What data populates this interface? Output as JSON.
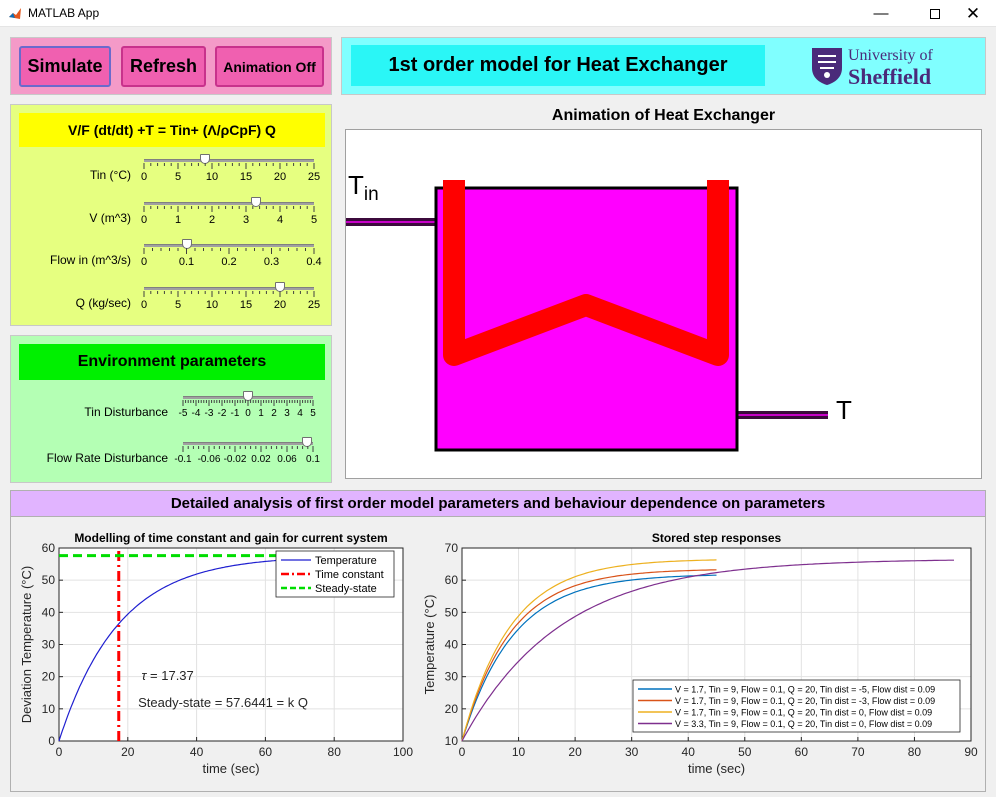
{
  "window": {
    "title": "MATLAB App"
  },
  "buttons": {
    "simulate": "Simulate",
    "refresh": "Refresh",
    "animation": "Animation Off"
  },
  "header": {
    "title": "1st order model for Heat Exchanger",
    "logo_line1": "University of",
    "logo_line2": "Sheffield"
  },
  "params": {
    "equation": "V/F (dt/dt) +T = Tin+ (Λ/ρCpF) Q",
    "sliders": [
      {
        "label": "Tin (°C)",
        "value": 9,
        "min": 0,
        "max": 25,
        "ticks": [
          "0",
          "5",
          "10",
          "15",
          "20",
          "25"
        ]
      },
      {
        "label": "V (m^3)",
        "value": 3.3,
        "min": 0,
        "max": 5,
        "ticks": [
          "0",
          "1",
          "2",
          "3",
          "4",
          "5"
        ]
      },
      {
        "label": "Flow in (m^3/s)",
        "value": 0.1,
        "min": 0,
        "max": 0.4,
        "ticks": [
          "0",
          "0.1",
          "0.2",
          "0.3",
          "0.4"
        ]
      },
      {
        "label": "Q (kg/sec)",
        "value": 20,
        "min": 0,
        "max": 25,
        "ticks": [
          "0",
          "5",
          "10",
          "15",
          "20",
          "25"
        ]
      }
    ]
  },
  "environment": {
    "title": "Environment parameters",
    "sliders": [
      {
        "label": "Tin Disturbance",
        "value": 0,
        "min": -5,
        "max": 5,
        "ticks": [
          "-5",
          "-4",
          "-3",
          "-2",
          "-1",
          "0",
          "1",
          "2",
          "3",
          "4",
          "5"
        ]
      },
      {
        "label": "Flow Rate Disturbance",
        "value": 0.09,
        "min": -0.1,
        "max": 0.1,
        "ticks": [
          "-0.1",
          "-0.06",
          "-0.02",
          "0.02",
          "0.06",
          "0.1"
        ]
      }
    ]
  },
  "animation": {
    "title": "Animation of Heat Exchanger",
    "tin_label": "T",
    "tin_sub": "in",
    "tout_label": "T"
  },
  "analysis": {
    "title": "Detailed analysis of first order model parameters and behaviour dependence on parameters"
  },
  "colors": {
    "tank": "#ff00ff",
    "coil": "#ff0000",
    "pipe": "#3c0a3c"
  },
  "chart_data": [
    {
      "type": "line",
      "title": "Modelling of time constant and gain for current system",
      "xlabel": "time (sec)",
      "ylabel": "Deviation Temperature (°C)",
      "xlim": [
        0,
        100
      ],
      "ylim": [
        0,
        60
      ],
      "xticks": [
        "0",
        "20",
        "40",
        "60",
        "80",
        "100"
      ],
      "yticks": [
        "0",
        "10",
        "20",
        "30",
        "40",
        "50",
        "60"
      ],
      "grid": true,
      "legend_position": "top-right",
      "series": [
        {
          "name": "Temperature",
          "color": "#1f1fd0",
          "style": "solid",
          "tau": 17.37,
          "k": 57.6441,
          "t_end": 87
        },
        {
          "name": "Time constant",
          "color": "#ff0000",
          "style": "dashdot",
          "x": [
            17.37,
            17.37
          ],
          "y": [
            0,
            60
          ]
        },
        {
          "name": "Steady-state",
          "color": "#00dd00",
          "style": "dashed",
          "x": [
            0,
            70
          ],
          "y": [
            57.6441,
            57.6441
          ]
        }
      ],
      "annotations": [
        {
          "symbol": "τ",
          "text": " =  17.37",
          "x": 24,
          "y": 19
        },
        {
          "text": "Steady-state = 57.6441 = k Q",
          "x": 23,
          "y": 10.5
        }
      ]
    },
    {
      "type": "line",
      "title": "Stored step responses",
      "xlabel": "time (sec)",
      "ylabel": "Temperature (°C)",
      "xlim": [
        0,
        90
      ],
      "ylim": [
        10,
        70
      ],
      "xticks": [
        "0",
        "10",
        "20",
        "30",
        "40",
        "50",
        "60",
        "70",
        "80",
        "90"
      ],
      "yticks": [
        "10",
        "20",
        "30",
        "40",
        "50",
        "60",
        "70"
      ],
      "grid": true,
      "legend_position": "bottom-right",
      "series": [
        {
          "name": "V = 1.7, Tin = 9, Flow = 0.1, Q = 20, Tin dist = -5, Flow dist = 0.09",
          "color": "#0072bd",
          "y0": 10,
          "yss": 61.9,
          "tau": 9.0,
          "t_end": 45
        },
        {
          "name": "V = 1.7, Tin = 9, Flow = 0.1, Q = 20, Tin dist = -3, Flow dist = 0.09",
          "color": "#d95319",
          "y0": 10,
          "yss": 63.5,
          "tau": 8.6,
          "t_end": 45
        },
        {
          "name": "V = 1.7, Tin = 9, Flow = 0.1, Q = 20, Tin dist = 0, Flow dist = 0.09",
          "color": "#edb120",
          "y0": 10,
          "yss": 66.6,
          "tau": 8.6,
          "t_end": 45
        },
        {
          "name": "V = 3.3, Tin = 9, Flow = 0.1, Q = 20, Tin dist = 0, Flow dist = 0.09",
          "color": "#7e2f8e",
          "y0": 10,
          "yss": 66.6,
          "tau": 17.37,
          "t_end": 87
        }
      ]
    }
  ]
}
